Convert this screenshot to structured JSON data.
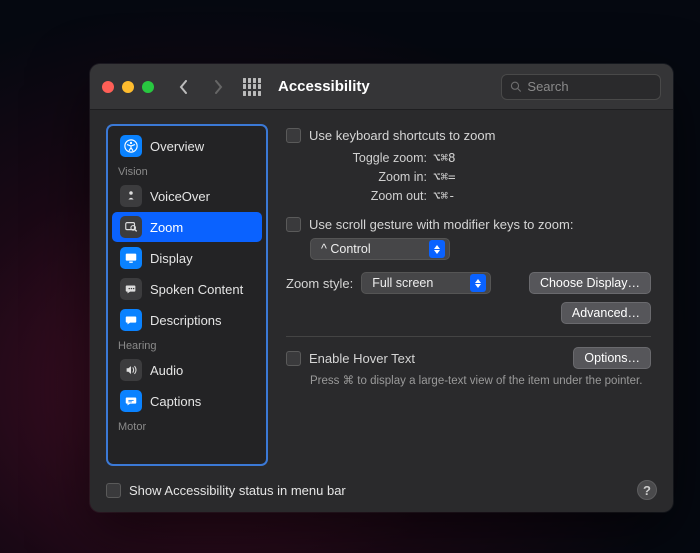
{
  "window": {
    "title": "Accessibility",
    "search_placeholder": "Search"
  },
  "sidebar": {
    "sections": {
      "vision": "Vision",
      "hearing": "Hearing",
      "motor": "Motor"
    },
    "items": {
      "overview": "Overview",
      "voiceover": "VoiceOver",
      "zoom": "Zoom",
      "display": "Display",
      "spoken": "Spoken Content",
      "descriptions": "Descriptions",
      "audio": "Audio",
      "captions": "Captions"
    }
  },
  "main": {
    "use_keyboard": "Use keyboard shortcuts to zoom",
    "shortcuts": {
      "toggle_label": "Toggle zoom:",
      "toggle_key": "⌥⌘8",
      "in_label": "Zoom in:",
      "in_key": "⌥⌘=",
      "out_label": "Zoom out:",
      "out_key": "⌥⌘-"
    },
    "use_scroll": "Use scroll gesture with modifier keys to zoom:",
    "modifier_select": "^ Control",
    "zoom_style_label": "Zoom style:",
    "zoom_style_value": "Full screen",
    "choose_display": "Choose Display…",
    "advanced": "Advanced…",
    "hover_text": "Enable Hover Text",
    "options": "Options…",
    "hover_hint": "Press ⌘ to display a large-text view of the item under the pointer."
  },
  "footer": {
    "show_status": "Show Accessibility status in menu bar"
  }
}
